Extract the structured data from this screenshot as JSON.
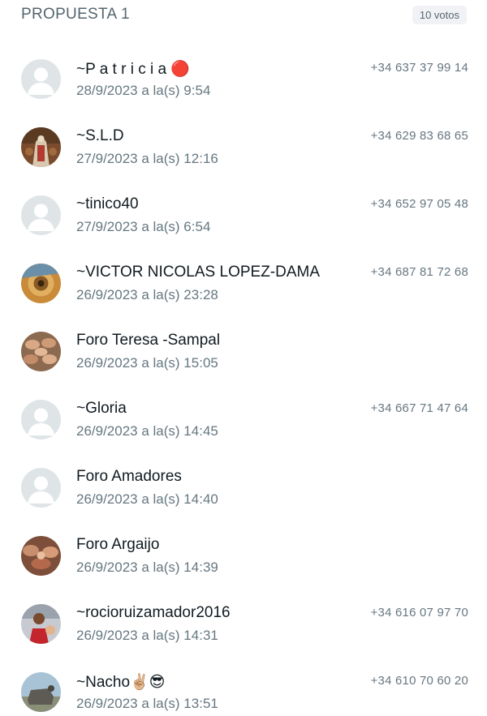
{
  "header": {
    "title": "PROPUESTA 1",
    "votes": "10 votos"
  },
  "voters": [
    {
      "name": "~P a t r i c i a 🔴",
      "time": "28/9/2023 a la(s) 9:54",
      "phone": "+34 637 37 99 14",
      "avatar": "default-avatar-icon"
    },
    {
      "name": "~S.L.D",
      "time": "27/9/2023 a la(s) 12:16",
      "phone": "+34 629 83 68 65",
      "avatar": "photo-avatar"
    },
    {
      "name": "~tinico40",
      "time": "27/9/2023 a la(s) 6:54",
      "phone": "+34 652 97 05 48",
      "avatar": "default-avatar-icon"
    },
    {
      "name": "~VICTOR NICOLAS LOPEZ-DAMA",
      "time": "26/9/2023 a la(s) 23:28",
      "phone": "+34 687 81 72 68",
      "avatar": "photo-avatar"
    },
    {
      "name": "Foro Teresa -Sampal",
      "time": "26/9/2023 a la(s) 15:05",
      "phone": "",
      "avatar": "photo-avatar"
    },
    {
      "name": "~Gloria",
      "time": "26/9/2023 a la(s) 14:45",
      "phone": "+34 667 71 47 64",
      "avatar": "default-avatar-icon"
    },
    {
      "name": "Foro Amadores",
      "time": "26/9/2023 a la(s) 14:40",
      "phone": "",
      "avatar": "default-avatar-icon"
    },
    {
      "name": "Foro Argaijo",
      "time": "26/9/2023 a la(s) 14:39",
      "phone": "",
      "avatar": "photo-avatar"
    },
    {
      "name": "~rocioruizamador2016",
      "time": "26/9/2023 a la(s) 14:31",
      "phone": "+34 616 07 97 70",
      "avatar": "photo-avatar"
    },
    {
      "name": "~Nacho✌🏼😎",
      "time": "26/9/2023 a la(s) 13:51",
      "phone": "+34 610 70 60 20",
      "avatar": "photo-avatar"
    }
  ],
  "colors": {
    "text_primary": "#111b21",
    "text_secondary": "#667781",
    "header_text": "#54656f",
    "badge_bg": "#f0f2f5",
    "default_avatar_bg": "#dfe5e7",
    "default_avatar_fg": "#ffffff"
  }
}
